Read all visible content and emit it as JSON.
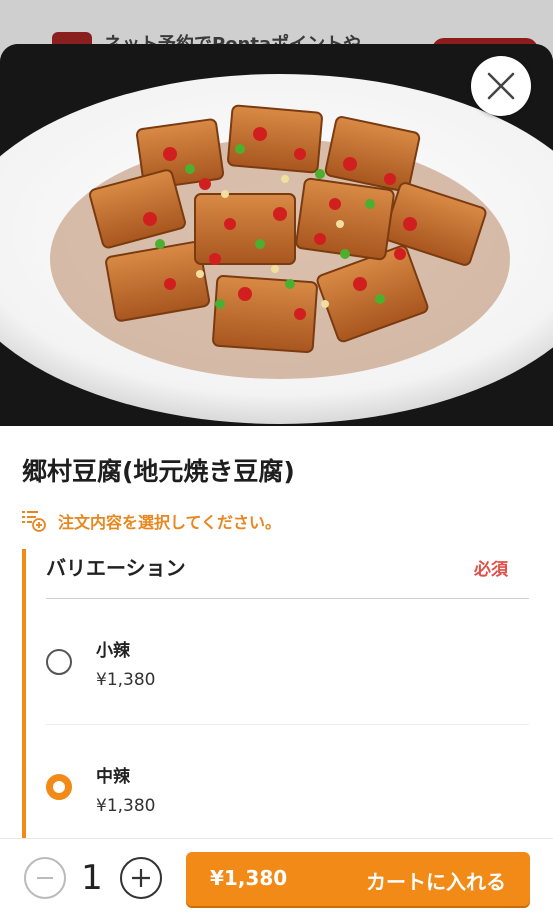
{
  "background_banner": {
    "text": "ネット予約でPontaポイントや"
  },
  "dish": {
    "title": "郷村豆腐(地元焼き豆腐)"
  },
  "hint": {
    "text": "注文内容を選択してください。"
  },
  "variation": {
    "title": "バリエーション",
    "required_label": "必須",
    "options": [
      {
        "name": "小辣",
        "price": "¥1,380",
        "selected": false
      },
      {
        "name": "中辣",
        "price": "¥1,380",
        "selected": true
      }
    ]
  },
  "order": {
    "quantity": "1",
    "price": "¥1,380",
    "add_to_cart_label": "カートに入れる"
  },
  "colors": {
    "accent": "#f28a17",
    "required": "#e0504a",
    "hint": "#e8871e"
  }
}
